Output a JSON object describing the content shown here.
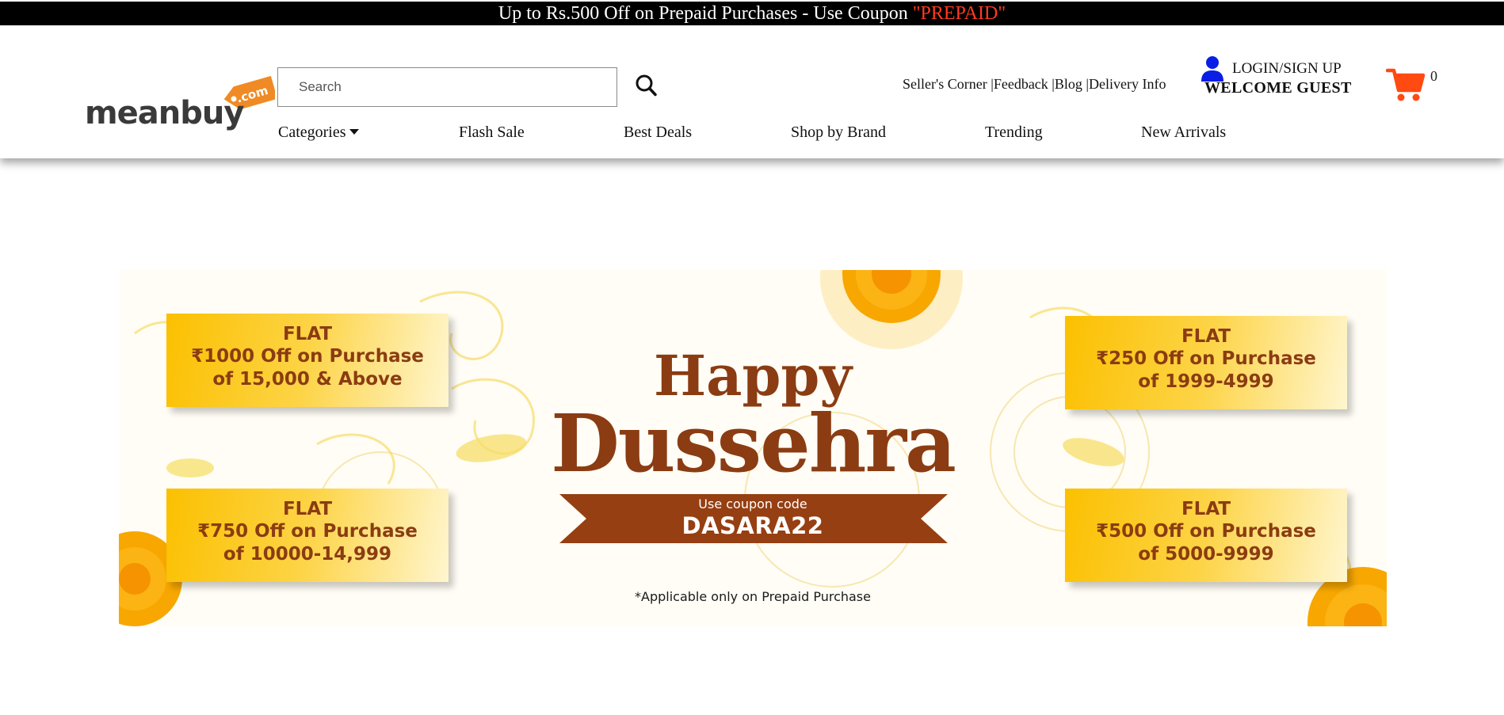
{
  "promo": {
    "text": "Up to Rs.500 Off on Prepaid Purchases - Use Coupon ",
    "coupon": "\"PREPAID\""
  },
  "header": {
    "logo": {
      "brand": "meanbuy",
      "tag": ".com"
    },
    "search": {
      "placeholder": "Search",
      "value": ""
    },
    "top_links": [
      "Seller's Corner |",
      "Feedback |",
      "Blog |",
      "Delivery Info"
    ],
    "login_label": "LOGIN/SIGN UP",
    "welcome": "WELCOME GUEST",
    "cart_count": "0"
  },
  "nav": {
    "items": [
      "Categories",
      "Flash Sale",
      "Best Deals",
      "Shop by Brand",
      "Trending",
      "New Arrivals"
    ]
  },
  "banner": {
    "offers": [
      {
        "flat": "FLAT",
        "line1": "₹1000 Off on Purchase",
        "line2": "of 15,000 & Above"
      },
      {
        "flat": "FLAT",
        "line1": "₹750 Off on Purchase",
        "line2": "of 10000-14,999"
      },
      {
        "flat": "FLAT",
        "line1": "₹250 Off on Purchase",
        "line2": "of 1999-4999"
      },
      {
        "flat": "FLAT",
        "line1": "₹500 Off on Purchase",
        "line2": "of 5000-9999"
      }
    ],
    "happy": "Happy",
    "dussehra": "Dussehra",
    "coupon_intro": "Use coupon code",
    "coupon_code": "DASARA22",
    "note": "*Applicable only on Prepaid Purchase"
  },
  "colors": {
    "promo_bg": "#000000",
    "coupon_accent": "#ff3b1f",
    "cart_orange": "#ff4a12",
    "user_icon_blue": "#0a1ee6",
    "banner_brown": "#8b3c12",
    "offer_yellow": "#fbc000"
  }
}
